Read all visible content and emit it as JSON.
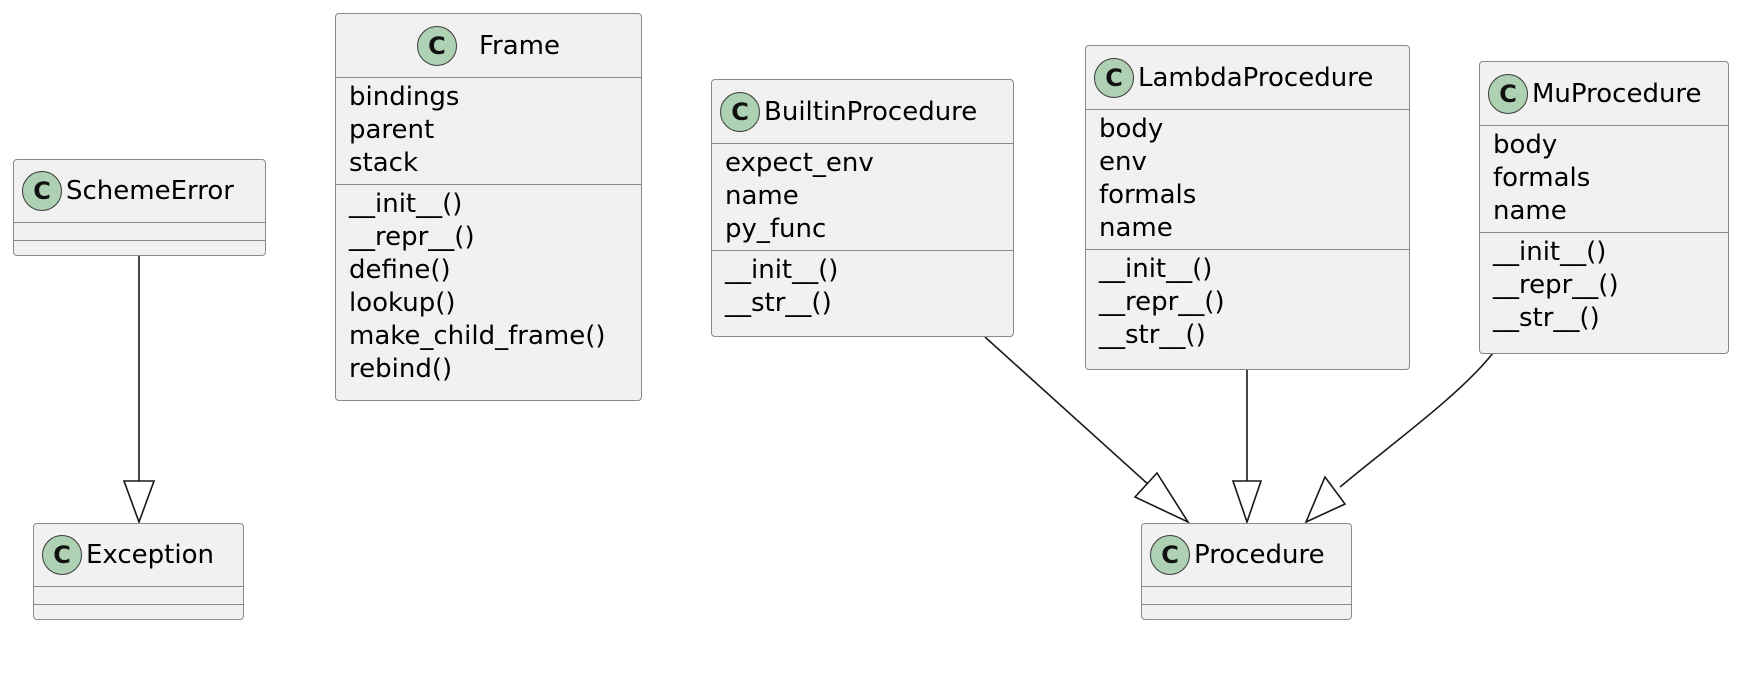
{
  "diagram": {
    "type": "UML class diagram",
    "classes": {
      "scheme_error": {
        "name": "SchemeError",
        "stereotype_icon": "C",
        "attributes": [],
        "methods": []
      },
      "exception": {
        "name": "Exception",
        "stereotype_icon": "C",
        "attributes": [],
        "methods": []
      },
      "frame": {
        "name": "Frame",
        "stereotype_icon": "C",
        "attributes": [
          "bindings",
          "parent",
          "stack"
        ],
        "methods": [
          "__init__()",
          "__repr__()",
          "define()",
          "lookup()",
          "make_child_frame()",
          "rebind()"
        ]
      },
      "builtin_procedure": {
        "name": "BuiltinProcedure",
        "stereotype_icon": "C",
        "attributes": [
          "expect_env",
          "name",
          "py_func"
        ],
        "methods": [
          "__init__()",
          "__str__()"
        ]
      },
      "lambda_procedure": {
        "name": "LambdaProcedure",
        "stereotype_icon": "C",
        "attributes": [
          "body",
          "env",
          "formals",
          "name"
        ],
        "methods": [
          "__init__()",
          "__repr__()",
          "__str__()"
        ]
      },
      "mu_procedure": {
        "name": "MuProcedure",
        "stereotype_icon": "C",
        "attributes": [
          "body",
          "formals",
          "name"
        ],
        "methods": [
          "__init__()",
          "__repr__()",
          "__str__()"
        ]
      },
      "procedure": {
        "name": "Procedure",
        "stereotype_icon": "C",
        "attributes": [],
        "methods": []
      }
    },
    "relations": [
      {
        "from": "SchemeError",
        "to": "Exception",
        "type": "inheritance"
      },
      {
        "from": "BuiltinProcedure",
        "to": "Procedure",
        "type": "inheritance"
      },
      {
        "from": "LambdaProcedure",
        "to": "Procedure",
        "type": "inheritance"
      },
      {
        "from": "MuProcedure",
        "to": "Procedure",
        "type": "inheritance"
      }
    ],
    "colors": {
      "class_fill": "#F1F1F1",
      "class_border": "#8A8A8A",
      "badge_fill": "#ADD1B2",
      "edge": "#181818"
    }
  }
}
